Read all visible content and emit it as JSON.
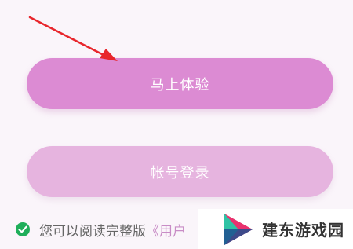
{
  "buttons": {
    "primary_label": "马上体验",
    "secondary_label": "帐号登录"
  },
  "agreement": {
    "text": "您可以阅读完整版",
    "link_text": "《用户"
  },
  "watermark": {
    "text": "建东游戏园"
  },
  "icons": {
    "check": "check-circle-icon",
    "arrow": "red-arrow-annotation",
    "logo": "play-triangle-logo"
  },
  "colors": {
    "primary_button": "#dc8bd3",
    "secondary_button": "#e6b4df",
    "arrow": "#e8262c",
    "check": "#1fae5a",
    "link": "#c88cc6"
  }
}
